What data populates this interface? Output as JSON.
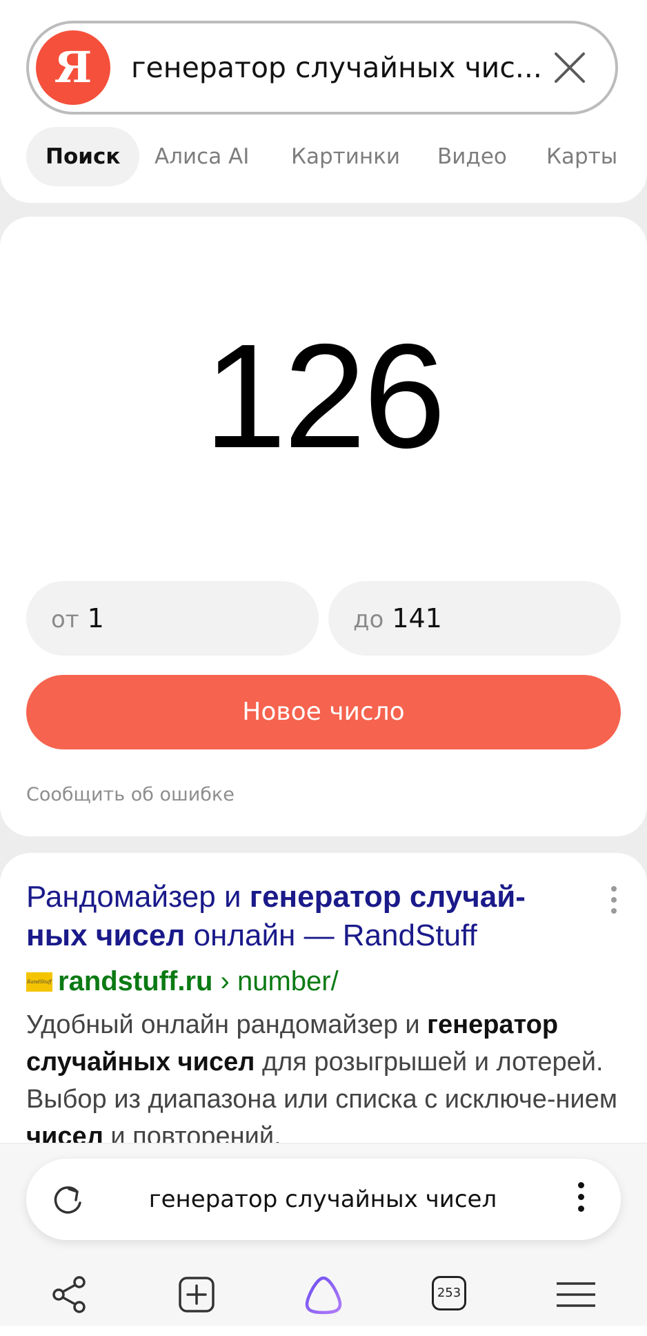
{
  "search": {
    "logo_letter": "Я",
    "query": "генератор случайных чис...",
    "icons": {
      "logo": "yandex-logo",
      "clear": "close-icon"
    }
  },
  "tabs": [
    {
      "label": "Поиск",
      "active": true
    },
    {
      "label": "Алиса AI",
      "active": false
    },
    {
      "label": "Картинки",
      "active": false
    },
    {
      "label": "Видео",
      "active": false
    },
    {
      "label": "Карты",
      "active": false
    }
  ],
  "generator": {
    "result": "126",
    "from_prefix": "от",
    "from_value": "1",
    "to_prefix": "до",
    "to_value": "141",
    "button_label": "Новое число",
    "report_link": "Сообщить об ошибке"
  },
  "result": {
    "title_part1": "Рандомайзер и ",
    "title_bold": "генератор случай-ных чисел",
    "title_part2": " онлайн — RandStuff",
    "favicon_text": "RandStuff",
    "domain": "randstuff.ru",
    "path": " › number/",
    "snippet": {
      "t1": "Удобный онлайн рандомайзер и ",
      "b1": "генератор случайных чисел",
      "t2": " для розыгрышей и лотерей. Выбор из диапазона или списка с исключе-нием ",
      "b2": "чисел",
      "t3": " и повторений."
    }
  },
  "bottom_bar": {
    "query": "генератор случайных чисел",
    "tab_count": "253",
    "icons": [
      "reload-icon",
      "more-vert-icon",
      "share-icon",
      "new-tab-icon",
      "alice-icon",
      "tabs-icon",
      "menu-icon"
    ]
  },
  "colors": {
    "accent": "#f6634e",
    "logo": "#f5503c",
    "link_title": "#1a1a8a",
    "url_green": "#0b7a14",
    "alice_purple": "#8c5cf0"
  }
}
